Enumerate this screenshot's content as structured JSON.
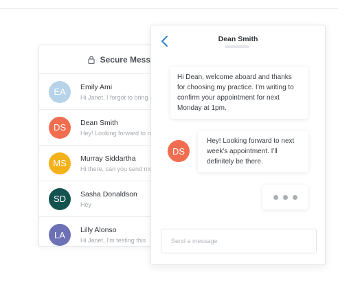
{
  "list": {
    "title": "Secure Messages",
    "lock_icon": "lock-icon",
    "conversations": [
      {
        "initials": "EA",
        "name": "Emily Ami",
        "preview": "Hi Janet, I forgot to bring an",
        "color": "#b7d3ea"
      },
      {
        "initials": "DS",
        "name": "Dean Smith",
        "preview": "Hey! Looking forward to next",
        "color": "#f16d4f"
      },
      {
        "initials": "MS",
        "name": "Murray Siddartha",
        "preview": "Hi there, can you send me a",
        "color": "#f4b21a"
      },
      {
        "initials": "SD",
        "name": "Sasha Donaldson",
        "preview": "Hey",
        "color": "#14524f"
      },
      {
        "initials": "LA",
        "name": "Lilly Alonso",
        "preview": "Hi Janet, I'm testing this",
        "color": "#6c70b5"
      }
    ]
  },
  "chat": {
    "contact_name": "Dean Smith",
    "back_icon": "chevron-left-icon",
    "messages": [
      {
        "from": "me",
        "text": "Hi Dean, welcome aboard and thanks for choosing my practice. I'm writing to confirm your appointment for next Monday at 1pm."
      },
      {
        "from": "Dean Smith",
        "initials": "DS",
        "text": "Hey! Looking forward to next week's appointment. I'll definitely be there."
      }
    ],
    "typing_indicator": true,
    "composer_placeholder": "Send a message"
  },
  "colors": {
    "accent": "#2d7fd3",
    "avatar_ds": "#f16d4f"
  }
}
